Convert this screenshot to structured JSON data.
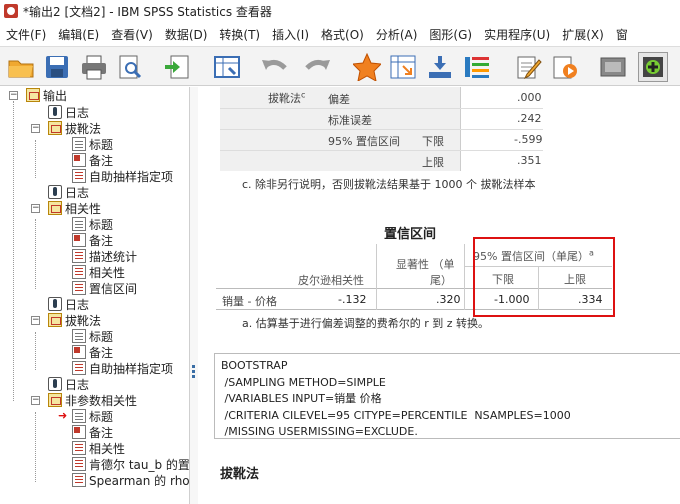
{
  "window": {
    "title": "*输出2 [文档2] - IBM SPSS Statistics 查看器"
  },
  "menu": [
    "文件(F)",
    "编辑(E)",
    "查看(V)",
    "数据(D)",
    "转换(T)",
    "插入(I)",
    "格式(O)",
    "分析(A)",
    "图形(G)",
    "实用程序(U)",
    "扩展(X)",
    "窗"
  ],
  "toolbar": {
    "icons": [
      "open-folder-icon",
      "save-icon",
      "print-icon",
      "print-preview-icon",
      "export-icon",
      "goto-data-icon",
      "undo-icon",
      "redo-icon",
      "star-icon",
      "pivot-icon",
      "insert-var-icon",
      "chart-builder-icon",
      "edit-icon",
      "run-icon",
      "hide-icon",
      "insert-icon"
    ]
  },
  "tree": {
    "root": "输出",
    "nodes": [
      {
        "label": "日志",
        "icon": "log"
      },
      {
        "label": "拔靴法",
        "icon": "book"
      },
      {
        "label": "标题",
        "icon": "doc"
      },
      {
        "label": "备注",
        "icon": "note"
      },
      {
        "label": "自助抽样指定项",
        "icon": "tbl"
      },
      {
        "label": "日志",
        "icon": "log"
      },
      {
        "label": "相关性",
        "icon": "book"
      },
      {
        "label": "标题",
        "icon": "doc"
      },
      {
        "label": "备注",
        "icon": "note"
      },
      {
        "label": "描述统计",
        "icon": "tbl"
      },
      {
        "label": "相关性",
        "icon": "tbl"
      },
      {
        "label": "置信区间",
        "icon": "tbl"
      },
      {
        "label": "日志",
        "icon": "log"
      },
      {
        "label": "拔靴法",
        "icon": "book"
      },
      {
        "label": "标题",
        "icon": "doc"
      },
      {
        "label": "备注",
        "icon": "note"
      },
      {
        "label": "自助抽样指定项",
        "icon": "tbl"
      },
      {
        "label": "日志",
        "icon": "log"
      },
      {
        "label": "非参数相关性",
        "icon": "book"
      },
      {
        "label": "标题",
        "icon": "doc"
      },
      {
        "label": "备注",
        "icon": "note"
      },
      {
        "label": "相关性",
        "icon": "tbl"
      },
      {
        "label": "肯德尔 tau_b 的置",
        "icon": "tbl"
      },
      {
        "label": "Spearman 的 rho |",
        "icon": "tbl"
      }
    ]
  },
  "bootstrap_top": {
    "row_label": "拔靴法",
    "superscript": "c",
    "rows": [
      {
        "label": "偏差",
        "value": ".000"
      },
      {
        "label": "标准误差",
        "value": ".242"
      },
      {
        "label": "95% 置信区间",
        "sub": "下限",
        "value": "-.599"
      },
      {
        "label": "",
        "sub": "上限",
        "value": ".351"
      }
    ],
    "footnote": "c. 除非另行说明，否则拔靴法结果基于 1000 个 拔靴法样本"
  },
  "ci_table": {
    "title": "置信区间",
    "col_pearson": "皮尔逊相关性",
    "col_sig_line1": "显著性 （单",
    "col_sig_line2": "尾）",
    "col_ci_header": "95% 置信区间（单尾）",
    "col_ci_sup": "a",
    "col_lower": "下限",
    "col_upper": "上限",
    "row_label": "销量 - 价格",
    "pearson": "-.132",
    "sig": ".320",
    "lower": "-1.000",
    "upper": ".334",
    "footnote": "a. 估算基于进行偏差调整的费希尔的 r 到 z 转换。"
  },
  "syntax": [
    "BOOTSTRAP",
    " /SAMPLING METHOD=SIMPLE",
    " /VARIABLES INPUT=销量 价格",
    " /CRITERIA CILEVEL=95 CITYPE=PERCENTILE  NSAMPLES=1000",
    " /MISSING USERMISSING=EXCLUDE."
  ],
  "next_heading": "拔靴法",
  "colors": {
    "highlight": "#dd1111",
    "label_bg": "#f0f0f0"
  }
}
